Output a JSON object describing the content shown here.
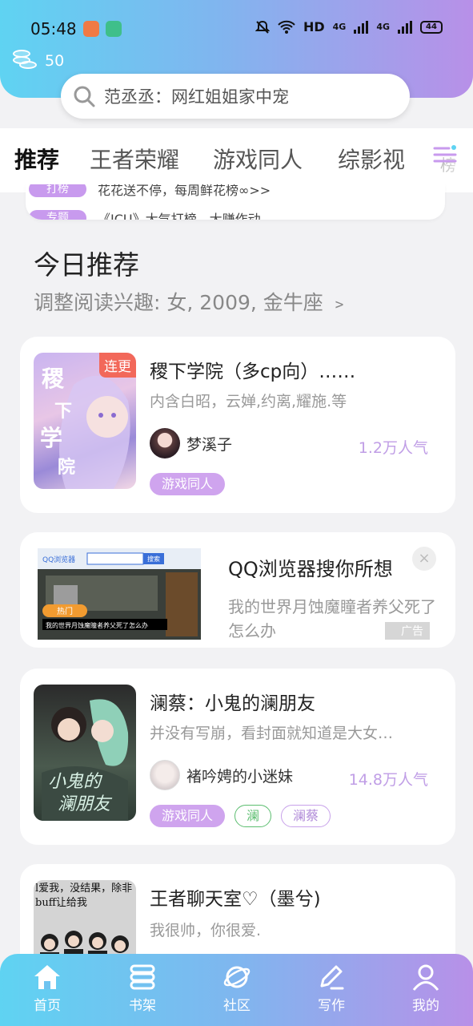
{
  "status_bar": {
    "time": "05:48",
    "network": "HD",
    "signal1": "4G",
    "signal2": "4G",
    "battery": "44"
  },
  "coins": {
    "count": "50"
  },
  "search": {
    "text": "范丞丞：网红姐姐家中宠"
  },
  "tabs": [
    {
      "label": "推荐",
      "active": true
    },
    {
      "label": "王者荣耀"
    },
    {
      "label": "游戏同人"
    },
    {
      "label": "综影视"
    },
    {
      "label": "榜"
    }
  ],
  "rank_card": {
    "row1_pill": "打榜",
    "row1_text": "花花送不停，每周鲜花榜∞>>",
    "row2_pill": "专题",
    "row2_text": "《ICU》大气打榜，大赚作动"
  },
  "section": {
    "title": "今日推荐",
    "subtitle": "调整阅读兴趣: 女, 2009, 金牛座 ﹥"
  },
  "books": [
    {
      "title": "稷下学院（多cp向）……",
      "desc": "内含白昭，云婵,约离,耀施.等",
      "author": "梦溪子",
      "popularity": "1.2万人气",
      "badge": "连更",
      "tags": [
        "游戏同人"
      ]
    },
    {
      "title": "澜蔡：小鬼的澜朋友",
      "desc": "并没有写崩，看封面就知道是大女…",
      "author": "褚吟娉的小迷妹",
      "popularity": "14.8万人气",
      "tags": [
        "游戏同人",
        "澜",
        "澜蔡"
      ]
    },
    {
      "title": "王者聊天室♡（墨兮)",
      "desc": "我很帅，你很爱."
    }
  ],
  "ad": {
    "title": "QQ浏览器搜你所想",
    "desc": "我的世界月蚀魔瞳者养父死了怎么办",
    "label": "广告",
    "close": "×",
    "image_brand": "QQ浏览器",
    "image_search_btn": "搜索",
    "image_hot": "热门",
    "image_caption": "我的世界月蚀魔瞳者养父死了怎么办"
  },
  "cover3_text": "l爱我，没结果，除非buff让给我",
  "bottom_nav": [
    {
      "label": "首页",
      "icon": "home-icon"
    },
    {
      "label": "书架",
      "icon": "bookshelf-icon"
    },
    {
      "label": "社区",
      "icon": "planet-icon"
    },
    {
      "label": "写作",
      "icon": "pen-icon"
    },
    {
      "label": "我的",
      "icon": "user-icon"
    }
  ],
  "colors": {
    "accent_purple": "#c89aee",
    "gradient_start": "#5fd3f2",
    "gradient_end": "#b890e8",
    "badge_red": "#f2685a"
  }
}
